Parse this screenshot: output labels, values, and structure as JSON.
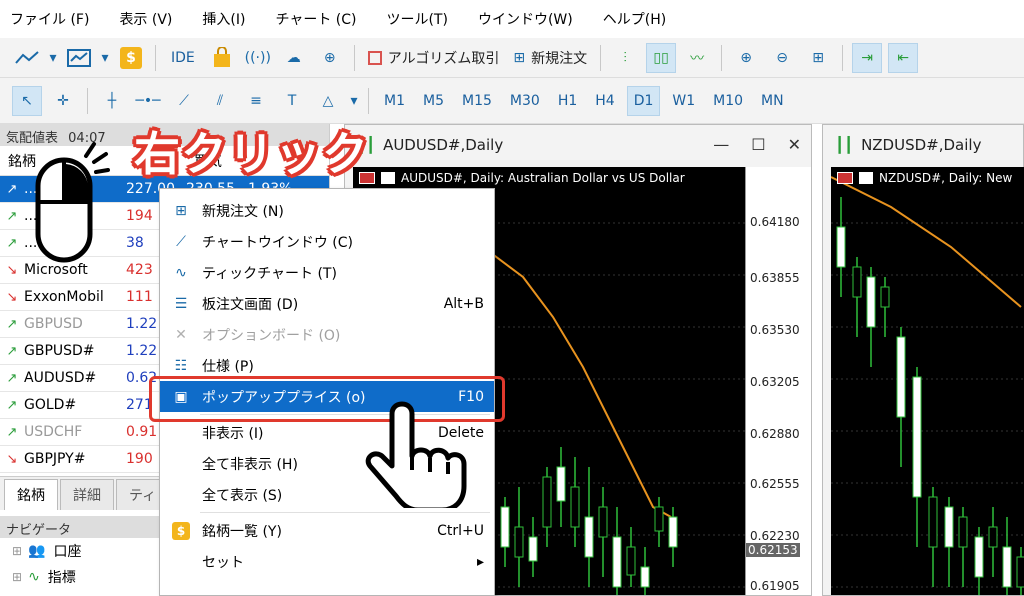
{
  "menubar": [
    "ファイル (F)",
    "表示 (V)",
    "挿入(I)",
    "チャート (C)",
    "ツール(T)",
    "ウインドウ(W)",
    "ヘルプ(H)"
  ],
  "toolbar1": {
    "ide": "IDE",
    "algo": "アルゴリズム取引",
    "neworder": "新規注文"
  },
  "timeframes": [
    "M1",
    "M5",
    "M15",
    "M30",
    "H1",
    "H4",
    "D1",
    "W1",
    "M10",
    "MN"
  ],
  "selected_timeframe": "D1",
  "market_watch": {
    "title": "気配値表",
    "time_partial": "04:07",
    "col_symbol": "銘柄",
    "col_bid_partial": "買気",
    "rows": [
      {
        "sym": "...ole",
        "bid": "227.00",
        "ask": "230.55",
        "chg": "1.93%",
        "dir": "up",
        "selected": true,
        "grey": false
      },
      {
        "sym": "...oogle",
        "bid": "194",
        "dir": "up",
        "selected": false,
        "grey": false,
        "bidcolor": "red"
      },
      {
        "sym": "...225Ca",
        "bid": "38",
        "dir": "up",
        "selected": false,
        "grey": false,
        "bidcolor": "blue"
      },
      {
        "sym": "Microsoft",
        "bid": "423",
        "dir": "down",
        "selected": false,
        "grey": false,
        "bidcolor": "red"
      },
      {
        "sym": "ExxonMobil",
        "bid": "111",
        "dir": "down",
        "selected": false,
        "grey": false,
        "bidcolor": "red"
      },
      {
        "sym": "GBPUSD",
        "bid": "1.22",
        "dir": "up",
        "selected": false,
        "grey": true,
        "bidcolor": "blue"
      },
      {
        "sym": "GBPUSD#",
        "bid": "1.22",
        "dir": "up",
        "selected": false,
        "grey": false,
        "bidcolor": "blue"
      },
      {
        "sym": "AUDUSD#",
        "bid": "0.62",
        "dir": "up",
        "selected": false,
        "grey": false,
        "bidcolor": "blue"
      },
      {
        "sym": "GOLD#",
        "bid": "271",
        "dir": "up",
        "selected": false,
        "grey": false,
        "bidcolor": "blue"
      },
      {
        "sym": "USDCHF",
        "bid": "0.91",
        "dir": "up",
        "selected": false,
        "grey": true,
        "bidcolor": "red"
      },
      {
        "sym": "GBPJPY#",
        "bid": "190",
        "dir": "down",
        "selected": false,
        "grey": false,
        "bidcolor": "red"
      }
    ],
    "tabs": [
      "銘柄",
      "詳細",
      "ティ"
    ]
  },
  "navigator": {
    "title": "ナビゲータ",
    "items": [
      "口座",
      "指標"
    ]
  },
  "chart1": {
    "title": "AUDUSD#,Daily",
    "label": "AUDUSD#, Daily:  Australian Dollar vs US Dollar",
    "prices": [
      "0.64180",
      "0.63855",
      "0.63530",
      "0.63205",
      "0.62880",
      "0.62555",
      "0.62230",
      "0.62153",
      "0.61905"
    ],
    "current": "0.62153"
  },
  "chart2": {
    "title": "NZDUSD#,Daily",
    "label": "NZDUSD#, Daily:  New"
  },
  "context_menu": [
    {
      "label": "新規注文 (N)",
      "shortcut": "",
      "icon": "plus-doc-icon",
      "state": "normal"
    },
    {
      "label": "チャートウインドウ (C)",
      "shortcut": "",
      "icon": "line-chart-icon",
      "state": "normal"
    },
    {
      "label": "ティックチャート (T)",
      "shortcut": "",
      "icon": "tick-chart-icon",
      "state": "normal"
    },
    {
      "label": "板注文画面 (D)",
      "shortcut": "Alt+B",
      "icon": "depth-icon",
      "state": "normal"
    },
    {
      "label": "オプションボード (O)",
      "shortcut": "",
      "icon": "option-icon",
      "state": "disabled"
    },
    {
      "label": "仕様 (P)",
      "shortcut": "",
      "icon": "spec-icon",
      "state": "normal"
    },
    {
      "label": "ポップアッププライス (o)",
      "shortcut": "F10",
      "icon": "popup-price-icon",
      "state": "highlight"
    },
    {
      "label": "非表示 (I)",
      "shortcut": "Delete",
      "icon": "",
      "state": "normal"
    },
    {
      "label": "全て非表示 (H)",
      "shortcut": "",
      "icon": "",
      "state": "normal"
    },
    {
      "label": "全て表示 (S)",
      "shortcut": "",
      "icon": "",
      "state": "normal"
    },
    {
      "label": "銘柄一覧 (Y)",
      "shortcut": "Ctrl+U",
      "icon": "dollar-icon",
      "state": "normal"
    },
    {
      "label": "セット",
      "shortcut": "",
      "icon": "",
      "state": "submenu"
    }
  ],
  "annotation": "右クリック",
  "colors": {
    "accent": "#0f6cc9",
    "highlight_border": "#e0392d",
    "up": "#2a9d3a",
    "down": "#d9302e"
  }
}
